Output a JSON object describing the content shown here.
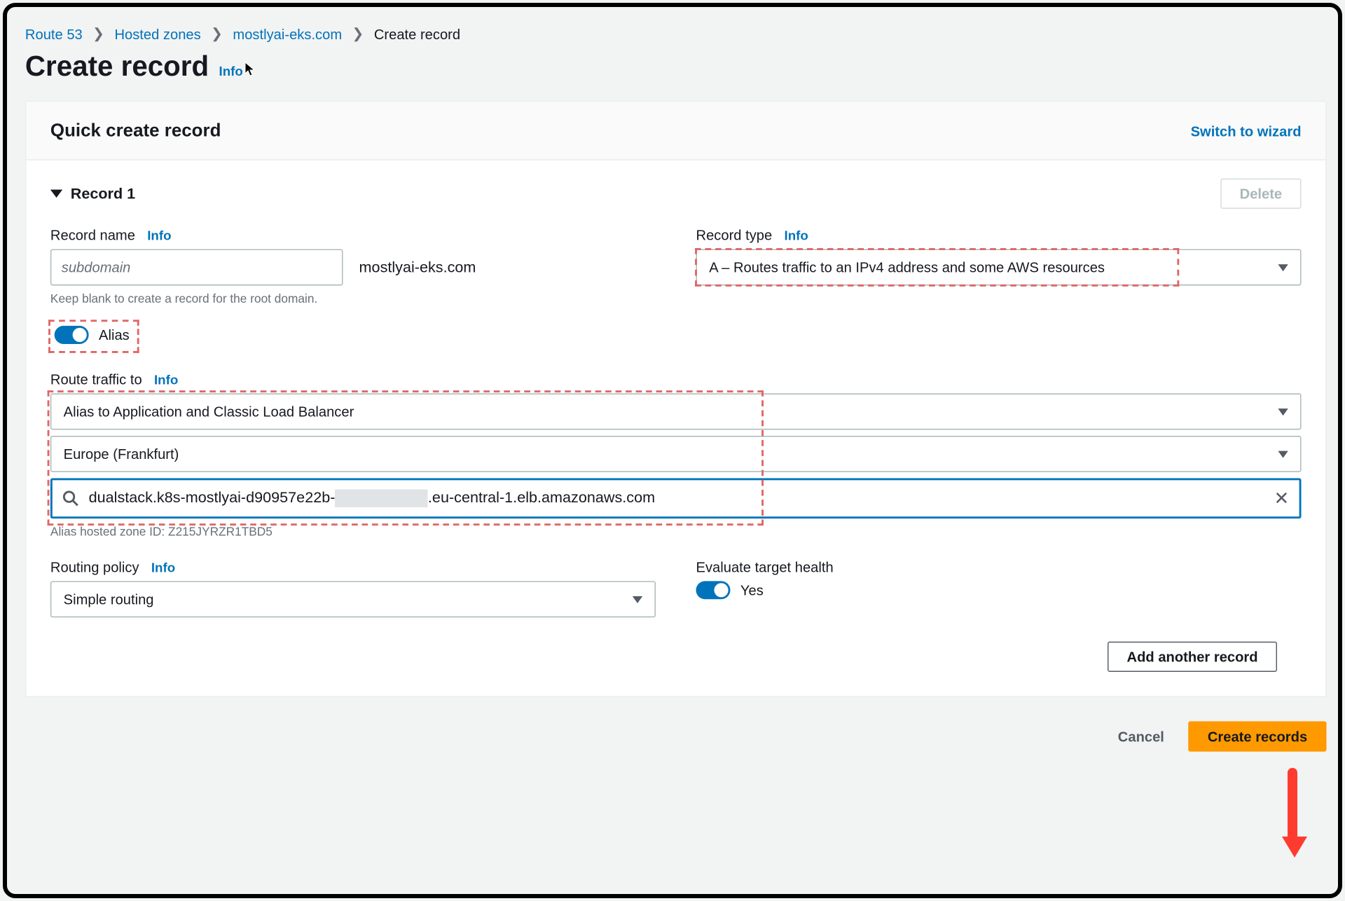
{
  "breadcrumb": {
    "items": [
      "Route 53",
      "Hosted zones",
      "mostlyai-eks.com"
    ],
    "current": "Create record"
  },
  "page_title": "Create record",
  "info_label": "Info",
  "panel_title": "Quick create record",
  "switch_link": "Switch to wizard",
  "record": {
    "title": "Record 1",
    "delete_label": "Delete",
    "name_label": "Record name",
    "name_placeholder": "subdomain",
    "domain_suffix": "mostlyai-eks.com",
    "name_hint": "Keep blank to create a record for the root domain.",
    "type_label": "Record type",
    "type_value": "A – Routes traffic to an IPv4 address and some AWS resources",
    "alias_label": "Alias",
    "route_label": "Route traffic to",
    "route_endpoint_type": "Alias to Application and Classic Load Balancer",
    "route_region": "Europe (Frankfurt)",
    "route_target_prefix": "dualstack.k8s-mostlyai-d90957e22b-",
    "route_target_suffix": ".eu-central-1.elb.amazonaws.com",
    "alias_zone_hint": "Alias hosted zone ID: Z215JYRZR1TBD5",
    "routing_policy_label": "Routing policy",
    "routing_policy_value": "Simple routing",
    "eval_health_label": "Evaluate target health",
    "eval_health_value": "Yes"
  },
  "footer": {
    "add_another": "Add another record",
    "cancel": "Cancel",
    "create": "Create records"
  }
}
